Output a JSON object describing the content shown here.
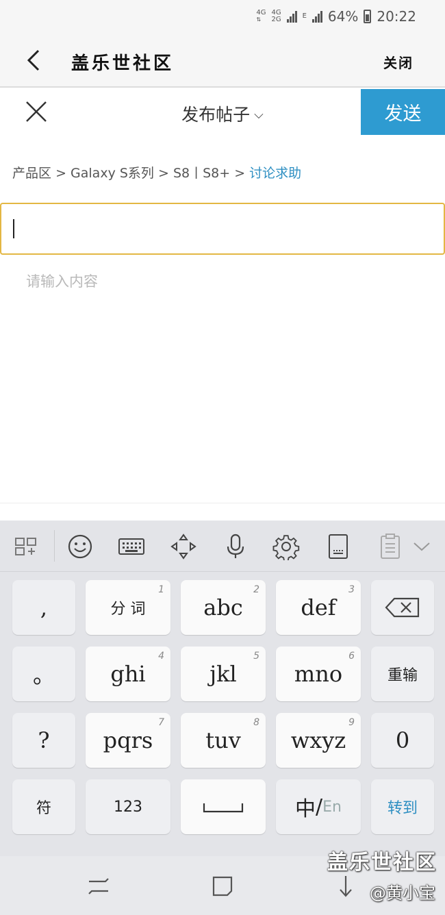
{
  "status_bar": {
    "network1": "4G",
    "network2": "4G",
    "network3": "2G",
    "network_e": "E",
    "battery": "64%",
    "time": "20:22"
  },
  "app_bar": {
    "title": "盖乐世社区",
    "close_label": "关闭"
  },
  "compose": {
    "title": "发布帖子",
    "send_label": "发送"
  },
  "breadcrumb": {
    "items": [
      "产品区",
      "Galaxy S系列",
      "S8丨S8+"
    ],
    "separator": ">",
    "active": "讨论求助"
  },
  "editor": {
    "title_value": "",
    "content_placeholder": "请输入内容"
  },
  "keyboard": {
    "toolbar_icons": [
      "grid-add-icon",
      "emoji-icon",
      "keyboard-icon",
      "cursor-move-icon",
      "microphone-icon",
      "settings-icon",
      "small-keyboard-icon",
      "clipboard-icon",
      "collapse-icon"
    ],
    "rows": [
      [
        {
          "label": ",",
          "num": ""
        },
        {
          "label": "分 词",
          "num": "1"
        },
        {
          "label": "abc",
          "num": "2"
        },
        {
          "label": "def",
          "num": "3"
        },
        {
          "label": "⌫",
          "num": ""
        }
      ],
      [
        {
          "label": "。",
          "num": ""
        },
        {
          "label": "ghi",
          "num": "4"
        },
        {
          "label": "jkl",
          "num": "5"
        },
        {
          "label": "mno",
          "num": "6"
        },
        {
          "label": "重输",
          "num": ""
        }
      ],
      [
        {
          "label": "?",
          "num": ""
        },
        {
          "label": "pqrs",
          "num": "7"
        },
        {
          "label": "tuv",
          "num": "8"
        },
        {
          "label": "wxyz",
          "num": "9"
        },
        {
          "label": "0",
          "num": ""
        }
      ],
      [
        {
          "label": "符",
          "num": ""
        },
        {
          "label": "123",
          "num": ""
        },
        {
          "label": "␣",
          "num": ""
        },
        {
          "label": "中/En",
          "num": ""
        },
        {
          "label": "转到",
          "num": ""
        }
      ]
    ],
    "lang_zh": "中",
    "lang_sep": "/",
    "lang_en": "En"
  },
  "watermark": {
    "line1": "盖乐世社区",
    "line2": "@黄小宝"
  },
  "colors": {
    "accent": "#2e9bd1",
    "focus_border": "#e3b743",
    "link": "#2e8fc2"
  }
}
